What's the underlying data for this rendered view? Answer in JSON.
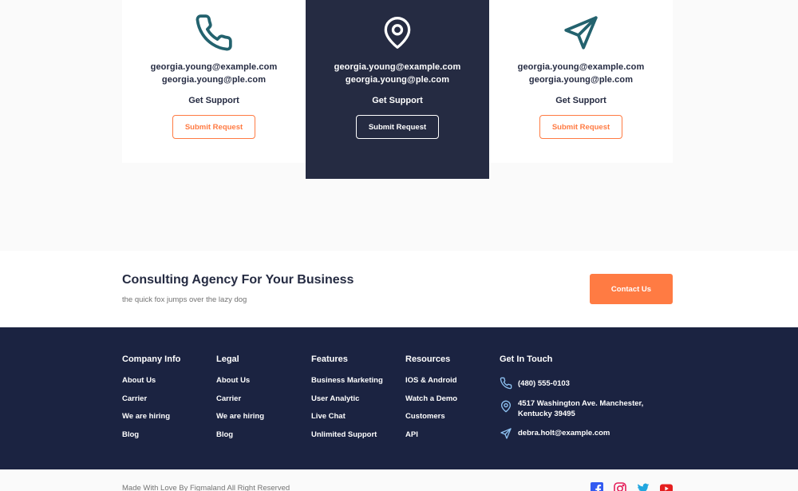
{
  "cards": [
    {
      "icon": "phone-icon",
      "email1": "georgia.young@example.com",
      "email2": "georgia.young@ple.com",
      "support": "Get Support",
      "button": "Submit Request"
    },
    {
      "icon": "location-pin-icon",
      "email1": "georgia.young@example.com",
      "email2": "georgia.young@ple.com",
      "support": "Get Support",
      "button": "Submit Request"
    },
    {
      "icon": "send-icon",
      "email1": "georgia.young@example.com",
      "email2": "georgia.young@ple.com",
      "support": "Get Support",
      "button": "Submit Request"
    }
  ],
  "cta": {
    "title": "Consulting Agency For Your Business",
    "subtitle": "the quick fox jumps over the lazy dog",
    "button": "Contact Us"
  },
  "footer": {
    "columns": [
      {
        "title": "Company Info",
        "links": [
          "About Us",
          "Carrier",
          "We are hiring",
          "Blog"
        ]
      },
      {
        "title": "Legal",
        "links": [
          "About Us",
          "Carrier",
          "We are hiring",
          "Blog"
        ]
      },
      {
        "title": "Features",
        "links": [
          "Business Marketing",
          "User Analytic",
          "Live Chat",
          "Unlimited Support"
        ]
      },
      {
        "title": "Resources",
        "links": [
          "IOS & Android",
          "Watch a Demo",
          "Customers",
          "API"
        ]
      }
    ],
    "touch": {
      "title": "Get In Touch",
      "phone": "(480) 555-0103",
      "address": "4517 Washington Ave. Manchester, Kentucky 39495",
      "email": "debra.holt@example.com"
    }
  },
  "bottom": {
    "copyright": "Made With Love By Figmaland All Right Reserved",
    "social": [
      "facebook-icon",
      "instagram-icon",
      "twitter-icon",
      "youtube-icon"
    ]
  },
  "colors": {
    "accent": "#FF7B43",
    "dark": "#252B42",
    "footer_bg": "#1B2341",
    "teal_icon": "#23626E",
    "muted": "#737373",
    "icon_blue": "#8EC2F2"
  }
}
